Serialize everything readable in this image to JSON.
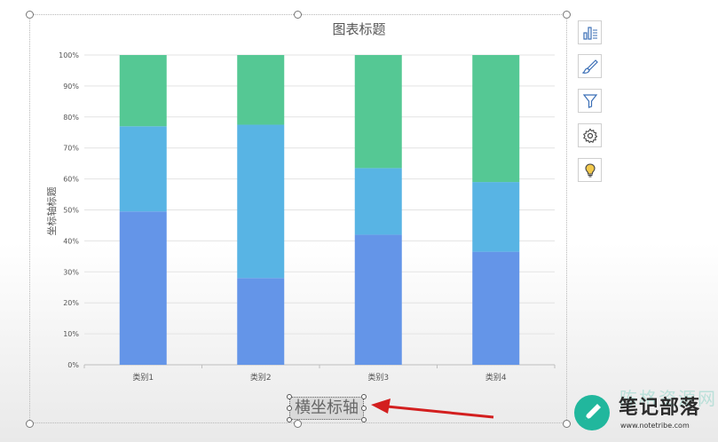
{
  "chart_data": {
    "type": "bar",
    "stacked": "percent",
    "title": "图表标题",
    "ylabel": "坐标轴标题",
    "xlabel": "横坐标轴",
    "categories": [
      "类别1",
      "类别2",
      "类别3",
      "类别4"
    ],
    "yticks": [
      "0%",
      "10%",
      "20%",
      "30%",
      "40%",
      "50%",
      "60%",
      "70%",
      "80%",
      "90%",
      "100%"
    ],
    "ylim": [
      0,
      100
    ],
    "grid": true,
    "series": [
      {
        "values": [
          49.5,
          28,
          42,
          36.5
        ],
        "color": "#6495e8"
      },
      {
        "values": [
          27.5,
          49.5,
          21.5,
          22.5
        ],
        "color": "#58b4e4"
      },
      {
        "values": [
          23,
          22.5,
          36.5,
          41
        ],
        "color": "#55c894"
      }
    ]
  },
  "side_buttons": [
    {
      "icon": "chart-elements-icon"
    },
    {
      "icon": "brush-style-icon"
    },
    {
      "icon": "filter-icon"
    },
    {
      "icon": "gear-icon"
    },
    {
      "icon": "lightbulb-icon"
    }
  ],
  "watermark": {
    "title": "笔记部落",
    "faded": "陈格资源网",
    "url": "www.notetribe.com"
  },
  "colors": {
    "arrow": "#d31f1f",
    "accent": "#21b79d"
  }
}
